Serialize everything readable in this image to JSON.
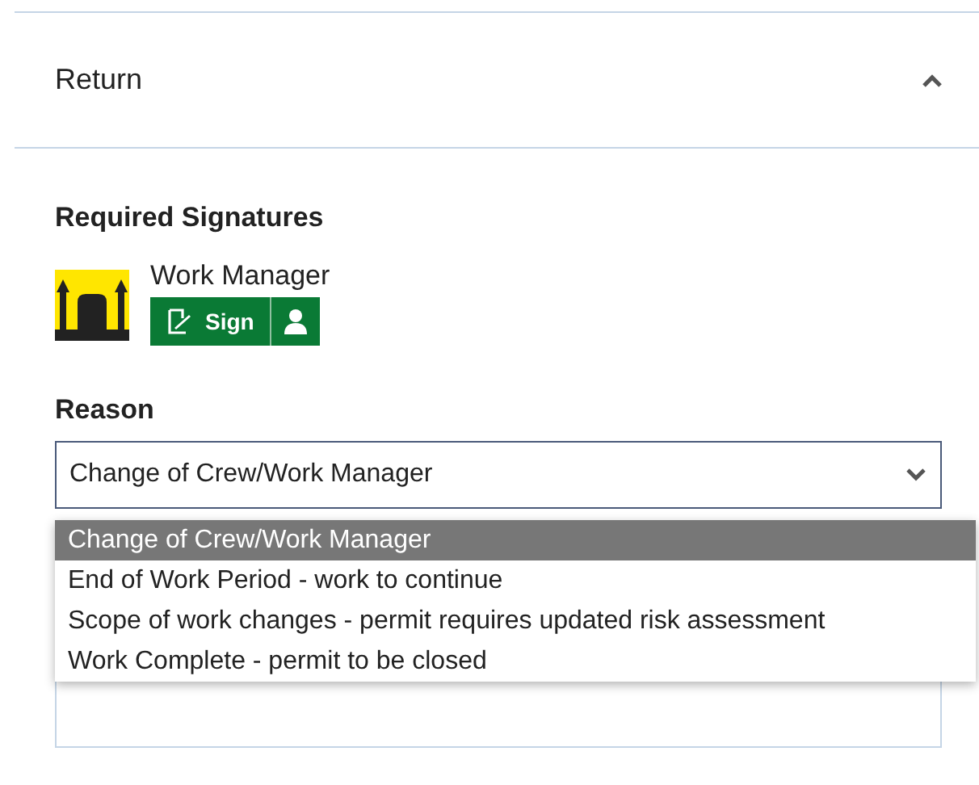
{
  "section": {
    "title": "Return",
    "expanded": true
  },
  "signatures": {
    "heading": "Required Signatures",
    "items": [
      {
        "role": "Work Manager",
        "sign_label": "Sign"
      }
    ]
  },
  "reason": {
    "label": "Reason",
    "value": "Change of Crew/Work Manager",
    "options": [
      {
        "label": "Change of Crew/Work Manager",
        "selected": true
      },
      {
        "label": "End of Work Period - work to continue",
        "selected": false
      },
      {
        "label": "Scope of work changes - permit requires updated risk assessment",
        "selected": false
      },
      {
        "label": "Work Complete - permit to be closed",
        "selected": false
      }
    ]
  }
}
